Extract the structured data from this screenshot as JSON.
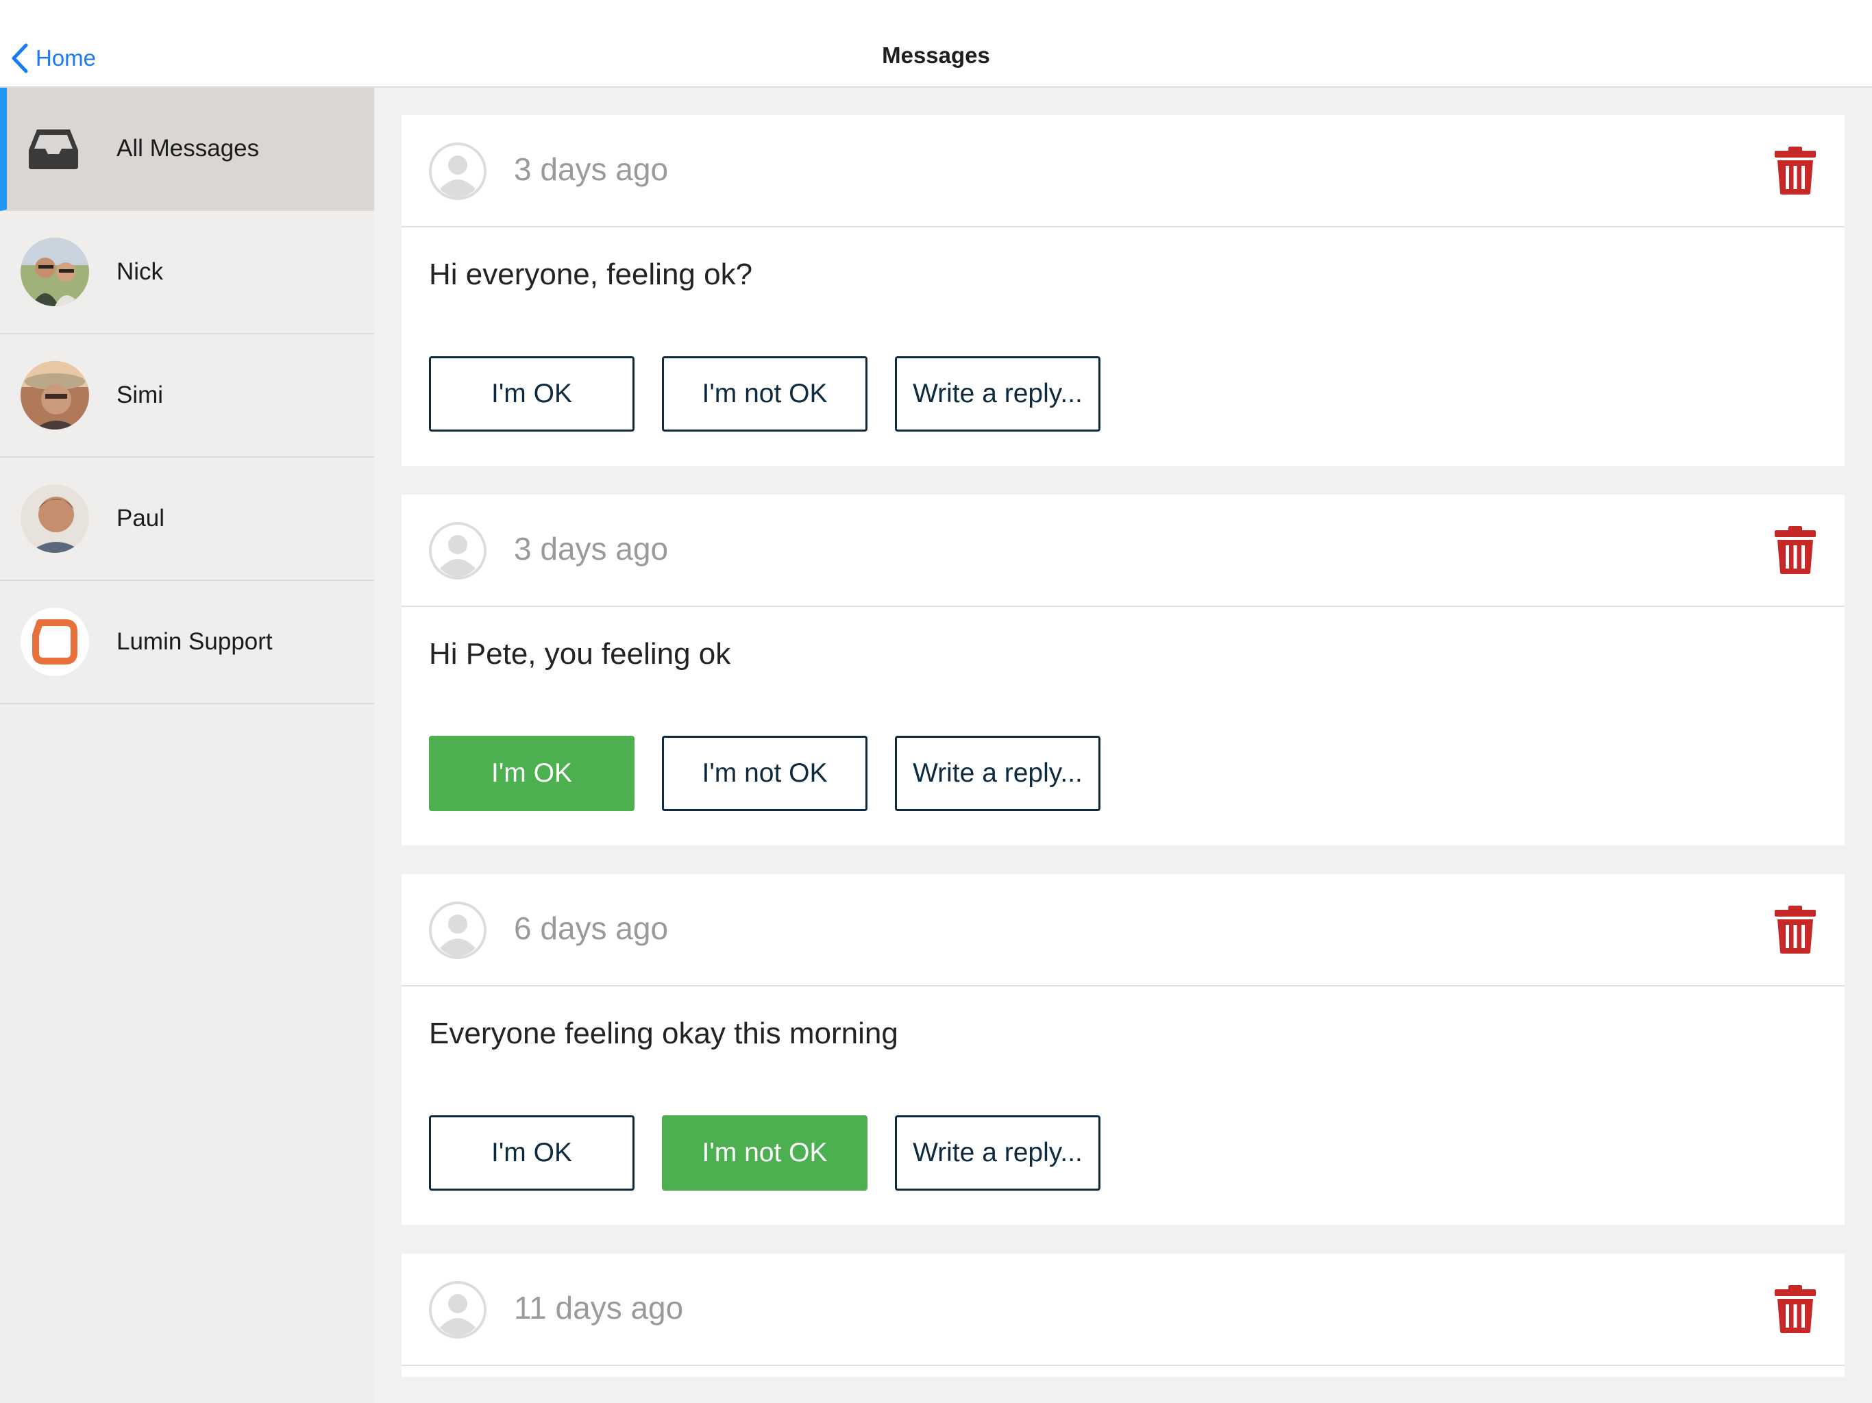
{
  "nav": {
    "back_label": "Home",
    "title": "Messages"
  },
  "sidebar": {
    "items": [
      {
        "label": "All Messages",
        "icon": "inbox-icon",
        "selected": true
      },
      {
        "label": "Nick",
        "icon": "avatar"
      },
      {
        "label": "Simi",
        "icon": "avatar"
      },
      {
        "label": "Paul",
        "icon": "avatar"
      },
      {
        "label": "Lumin Support",
        "icon": "lumin-logo"
      }
    ]
  },
  "messages": [
    {
      "time": "3 days ago",
      "text": "Hi everyone, feeling ok?",
      "buttons": [
        "I'm OK",
        "I'm not OK",
        "Write a reply..."
      ],
      "selected": null
    },
    {
      "time": "3 days ago",
      "text": "Hi Pete, you feeling ok",
      "buttons": [
        "I'm OK",
        "I'm not OK",
        "Write a reply..."
      ],
      "selected": "I'm OK"
    },
    {
      "time": "6 days ago",
      "text": "Everyone feeling okay this morning",
      "buttons": [
        "I'm OK",
        "I'm not OK",
        "Write a reply..."
      ],
      "selected": "I'm not OK"
    },
    {
      "time": "11 days ago"
    }
  ],
  "colors": {
    "accent": "#1a7cf0",
    "selected_bar": "#2196f3",
    "button_active": "#4caf50",
    "trash": "#c62828",
    "button_border": "#0e2a3e",
    "lumin_orange": "#e8703a"
  }
}
